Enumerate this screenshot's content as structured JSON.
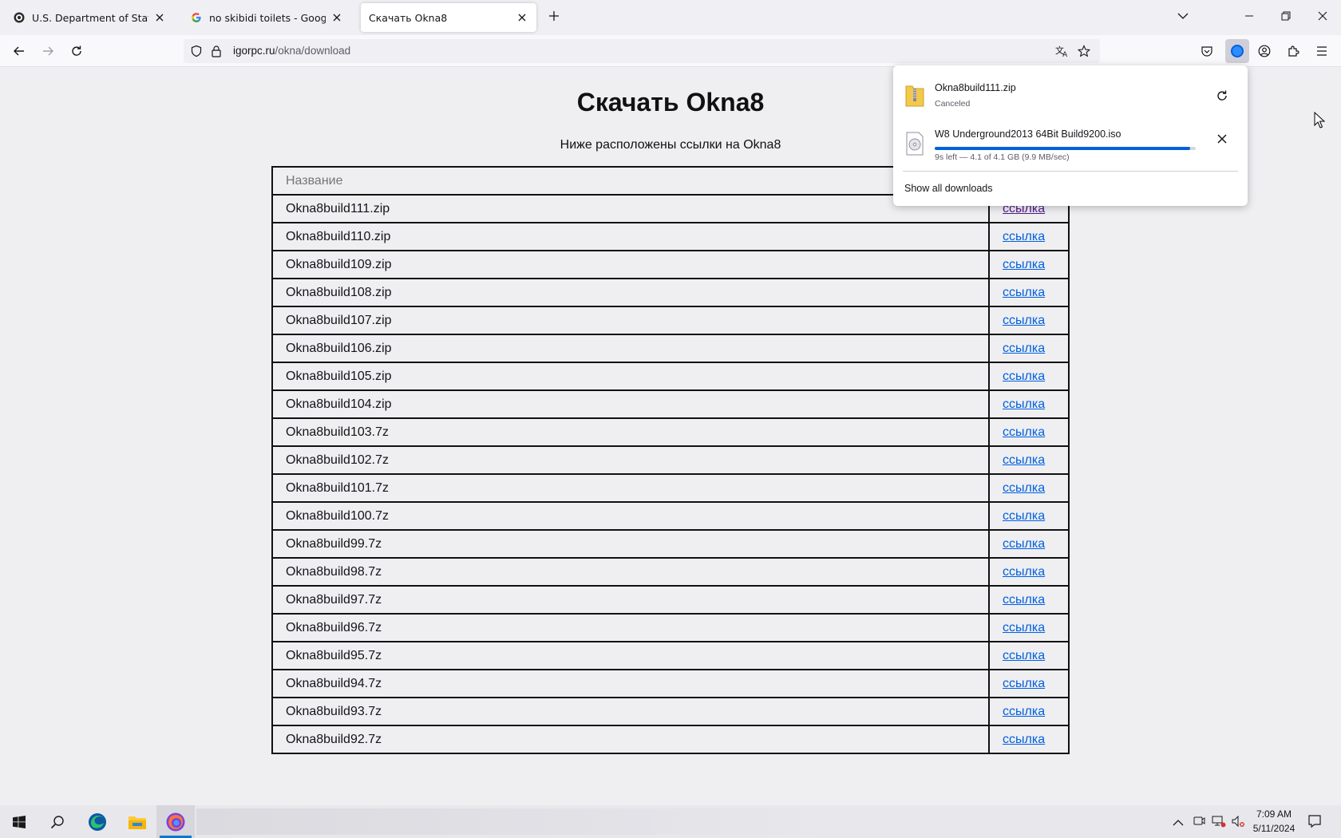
{
  "tabs": [
    {
      "title": "U.S. Department of State Conc",
      "icon": "seal-icon"
    },
    {
      "title": "no skibidi toilets - Google Searc",
      "icon": "google-icon"
    },
    {
      "title": "Скачать Okna8",
      "icon": "none"
    }
  ],
  "address": {
    "domain": "igorpc.ru",
    "path": "/okna/download"
  },
  "page": {
    "heading": "Скачать Okna8",
    "subtitle": "Ниже расположены ссылки на Okna8",
    "column_name_header": "Название",
    "rows": [
      {
        "name": "Okna8build111.zip",
        "link": "ссылка"
      },
      {
        "name": "Okna8build110.zip",
        "link": "ссылка"
      },
      {
        "name": "Okna8build109.zip",
        "link": "ссылка"
      },
      {
        "name": "Okna8build108.zip",
        "link": "ссылка"
      },
      {
        "name": "Okna8build107.zip",
        "link": "ссылка"
      },
      {
        "name": "Okna8build106.zip",
        "link": "ссылка"
      },
      {
        "name": "Okna8build105.zip",
        "link": "ссылка"
      },
      {
        "name": "Okna8build104.zip",
        "link": "ссылка"
      },
      {
        "name": "Okna8build103.7z",
        "link": "ссылка"
      },
      {
        "name": "Okna8build102.7z",
        "link": "ссылка"
      },
      {
        "name": "Okna8build101.7z",
        "link": "ссылка"
      },
      {
        "name": "Okna8build100.7z",
        "link": "ссылка"
      },
      {
        "name": "Okna8build99.7z",
        "link": "ссылка"
      },
      {
        "name": "Okna8build98.7z",
        "link": "ссылка"
      },
      {
        "name": "Okna8build97.7z",
        "link": "ссылка"
      },
      {
        "name": "Okna8build96.7z",
        "link": "ссылка"
      },
      {
        "name": "Okna8build95.7z",
        "link": "ссылка"
      },
      {
        "name": "Okna8build94.7z",
        "link": "ссылка"
      },
      {
        "name": "Okna8build93.7z",
        "link": "ссылка"
      },
      {
        "name": "Okna8build92.7z",
        "link": "ссылка"
      }
    ]
  },
  "downloads_panel": {
    "items": [
      {
        "name": "Okna8build111.zip",
        "status": "Canceled",
        "icon": "zip-folder-icon",
        "action_icon": "retry-icon"
      },
      {
        "name": "W8 Underground2013 64Bit Build9200.iso",
        "status": "9s left — 4.1 of 4.1 GB (9.9 MB/sec)",
        "icon": "disc-image-icon",
        "action_icon": "cancel-icon",
        "progress": 0.98
      }
    ],
    "show_all_label": "Show all downloads"
  },
  "taskbar": {
    "time": "7:09 AM",
    "date": "5/11/2024"
  },
  "colors": {
    "link": "#0060df",
    "accent": "#0060df",
    "taskbar_accent": "#0078d4"
  }
}
